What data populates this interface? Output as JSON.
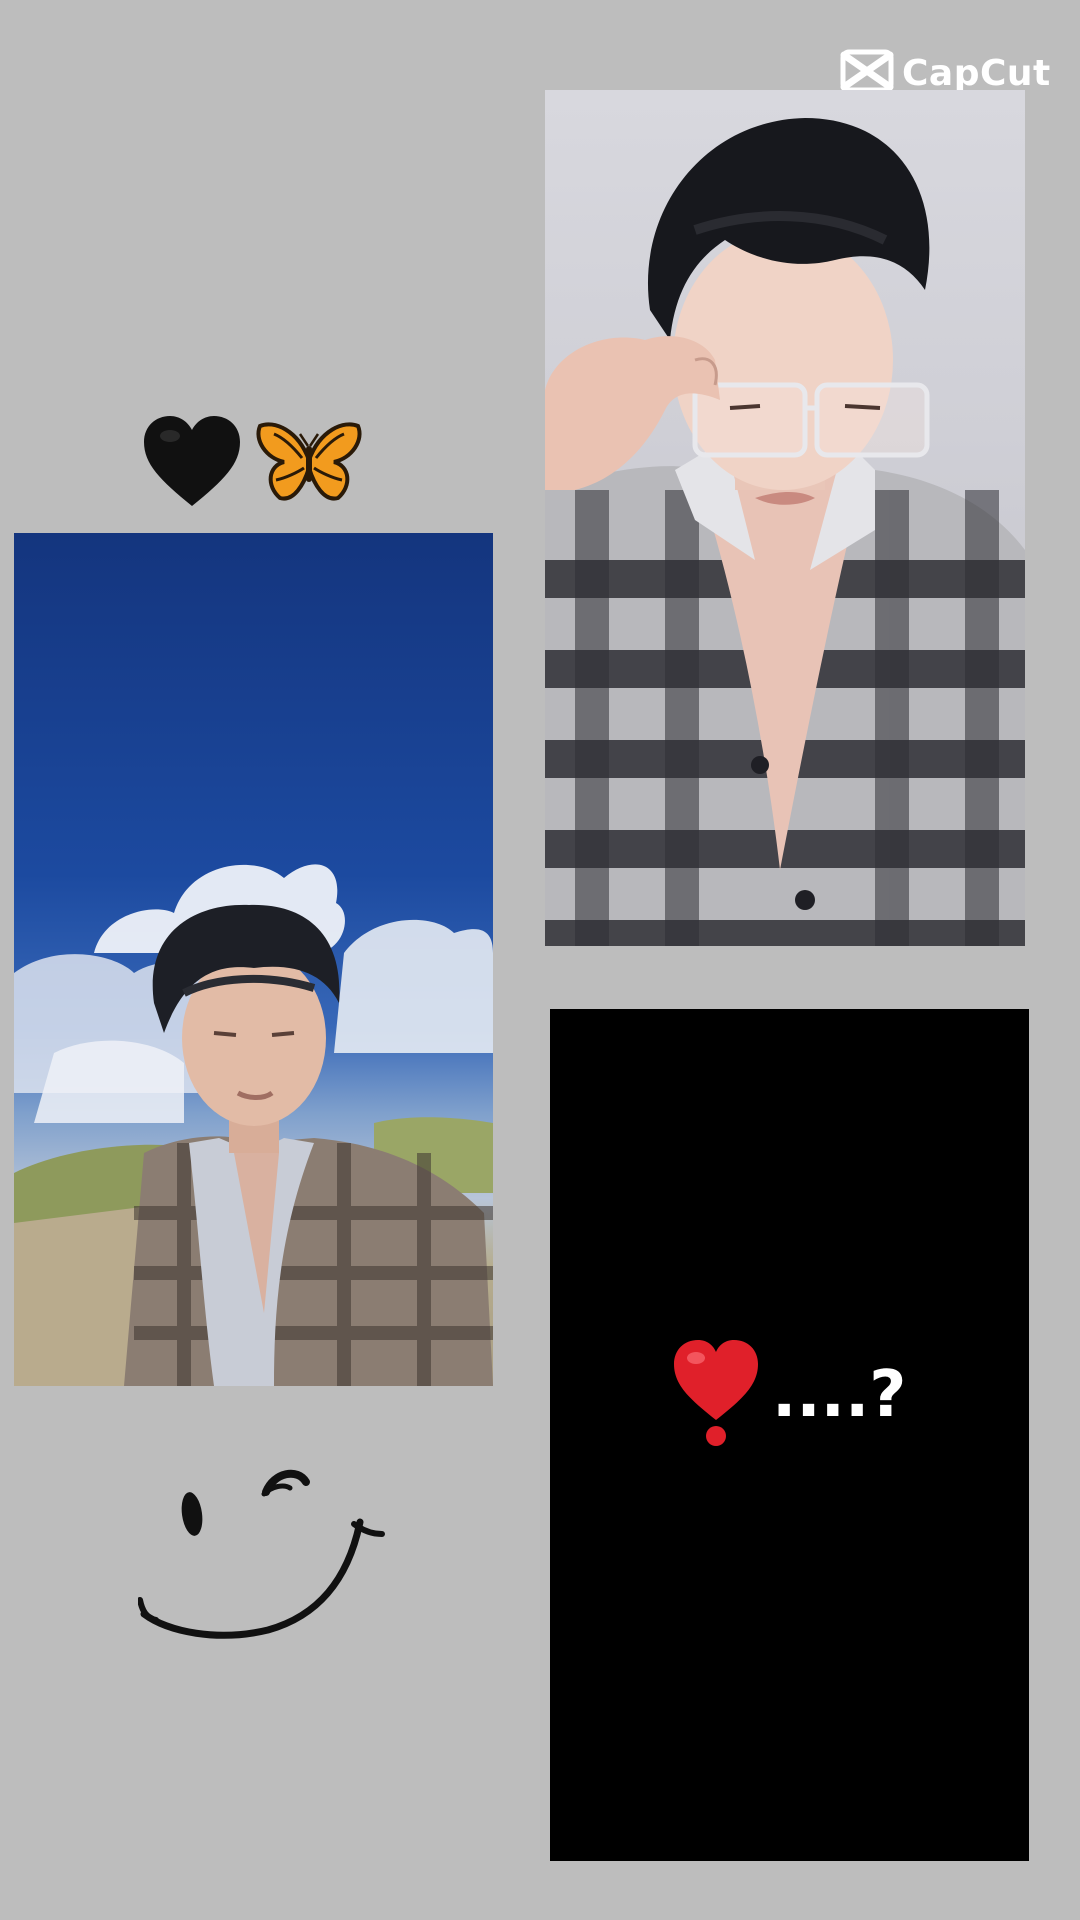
{
  "watermark": {
    "icon": "capcut-logo-icon",
    "text": "CapCut"
  },
  "emoji_row": {
    "items": [
      "black-heart-icon",
      "butterfly-icon"
    ],
    "colors": {
      "heart": "#111111",
      "butterfly": "#f29b1e"
    }
  },
  "photos": [
    {
      "name": "sky-portrait-photo",
      "description_icon": "person-photo"
    },
    {
      "name": "glasses-portrait-photo",
      "description_icon": "person-photo"
    }
  ],
  "black_card": {
    "heart_icon": "heart-exclamation-icon",
    "caption": "....?",
    "heart_color": "#e0202a"
  },
  "decoration": {
    "icon": "wink-smiley-icon"
  },
  "colors": {
    "background": "#bdbdbd",
    "card": "#000000",
    "text_on_card": "#ffffff"
  }
}
